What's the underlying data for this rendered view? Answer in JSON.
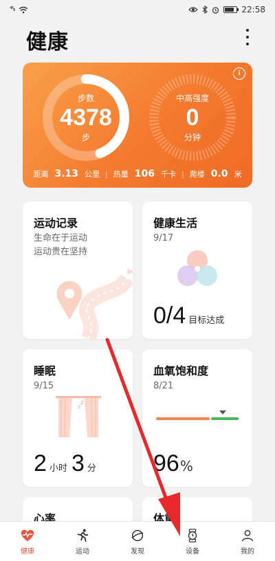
{
  "status_bar": {
    "signal": "⁴⁶ᵢₗₗ",
    "time": "22:58",
    "icons": [
      "signal-icon",
      "wifi-icon",
      "eye-icon",
      "bluetooth-icon",
      "alarm-icon",
      "battery-icon"
    ]
  },
  "header": {
    "title": "健康",
    "menu_icon": "more-vertical-icon"
  },
  "hero": {
    "accent_from": "#f9a04a",
    "accent_to": "#ef6a26",
    "steps": {
      "label": "步数",
      "value": "4378",
      "unit": "步",
      "progress": 0.44
    },
    "intensity": {
      "label": "中高强度",
      "value": "0",
      "unit": "分钟",
      "progress": 0
    },
    "stats": {
      "distance_label": "距离",
      "distance_value": "3.13",
      "distance_unit": "公里",
      "calorie_label": "热量",
      "calorie_value": "106",
      "calorie_unit": "千卡",
      "floors_label": "爬楼",
      "floors_value": "0.0",
      "floors_unit": "米"
    }
  },
  "cards": {
    "exercise": {
      "title": "运动记录",
      "line1": "生命在于运动",
      "line2": "运动贵在坚持"
    },
    "life": {
      "title": "健康生活",
      "date": "9/17",
      "value": "0/4",
      "unit": "目标达成"
    },
    "sleep": {
      "title": "睡眠",
      "date": "9/15",
      "hours": "2",
      "hours_unit": "小时",
      "minutes": "3",
      "minutes_unit": "分"
    },
    "spo2": {
      "title": "血氧饱和度",
      "date": "8/21",
      "value": "96",
      "unit": "%"
    },
    "heart": {
      "title": "心率"
    },
    "weight": {
      "title": "体重"
    }
  },
  "nav": {
    "items": [
      {
        "label": "健康",
        "icon": "heart-pulse-icon",
        "active": true
      },
      {
        "label": "运动",
        "icon": "running-icon",
        "active": false
      },
      {
        "label": "发现",
        "icon": "planet-icon",
        "active": false
      },
      {
        "label": "设备",
        "icon": "watch-icon",
        "active": false
      },
      {
        "label": "我的",
        "icon": "user-icon",
        "active": false
      }
    ],
    "active_color": "#e8533a"
  },
  "annotation": {
    "arrow_color": "#e8282a"
  }
}
